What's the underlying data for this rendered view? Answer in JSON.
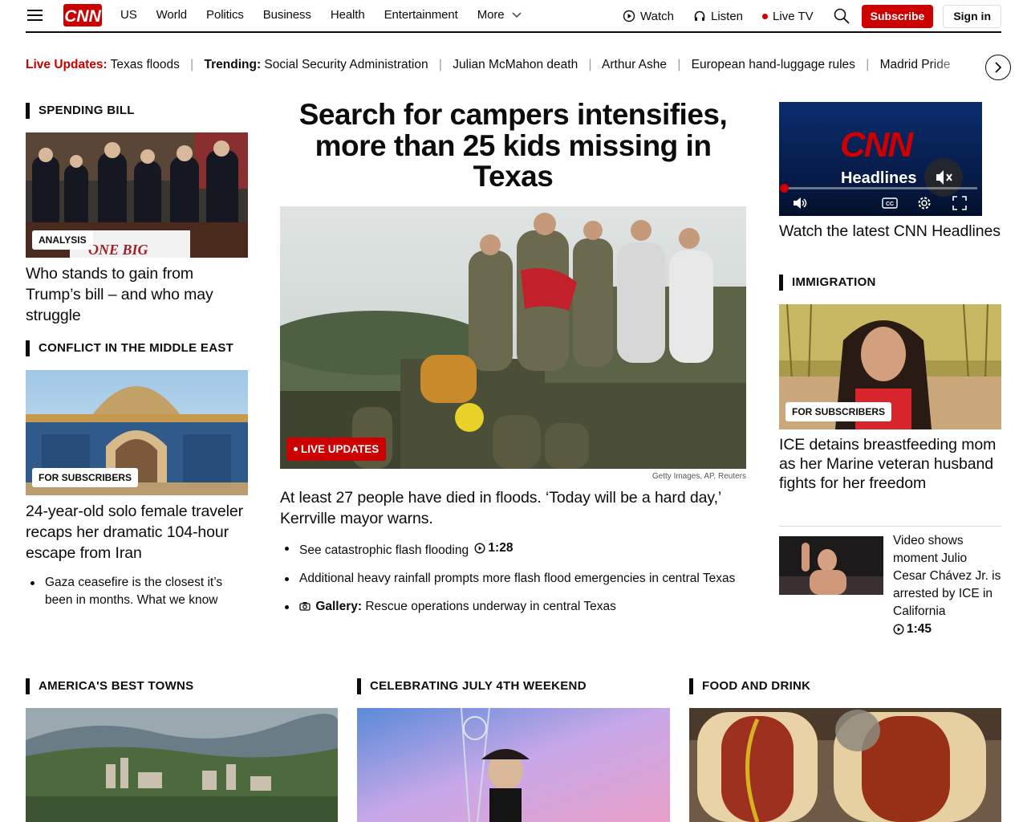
{
  "header": {
    "logo_text": "CNN",
    "nav": [
      "US",
      "World",
      "Politics",
      "Business",
      "Health",
      "Entertainment"
    ],
    "more_label": "More",
    "watch_label": "Watch",
    "listen_label": "Listen",
    "livetv_label": "Live TV",
    "subscribe_label": "Subscribe",
    "signin_label": "Sign in"
  },
  "ticker": {
    "live_label": "Live Updates:",
    "live_item": "Texas floods",
    "trending_label": "Trending:",
    "items": [
      "Social Security Administration",
      "Julian McMahon death",
      "Arthur Ashe",
      "European hand-luggage rules",
      "Madrid Pride"
    ]
  },
  "left": {
    "s1_label": "SPENDING BILL",
    "s1_badge": "ANALYSIS",
    "s1_banner": "ONE BIG",
    "s1_headline": "Who stands to gain from Trump’s bill – and who may struggle",
    "s2_label": "CONFLICT IN THE MIDDLE EAST",
    "s2_badge": "FOR SUBSCRIBERS",
    "s2_headline": "24-year-old solo female traveler recaps her dramatic 104-hour escape from Iran",
    "s2_bullet": "Gaza ceasefire is the closest it’s been in months. What we know"
  },
  "main": {
    "title": "Search for campers intensifies, more than 25 kids missing in Texas",
    "live_badge": "LIVE UPDATES",
    "credit": "Getty Images, AP, Reuters",
    "subhead": "At least 27 people have died in floods. ‘Today will be a hard day,’ Kerrville mayor warns.",
    "bullet1": "See catastrophic flash flooding",
    "bullet1_duration": "1:28",
    "bullet2": "Additional heavy rainfall prompts more flash flood emergencies in central Texas",
    "bullet3_label": "Gallery:",
    "bullet3": "Rescue operations underway in central Texas"
  },
  "right": {
    "video_brand": "CNN",
    "video_title": "Headlines",
    "video_caption": "Watch the latest CNN Headlines",
    "s_label": "IMMIGRATION",
    "s_badge": "FOR SUBSCRIBERS",
    "s_headline": "ICE detains breastfeeding mom as her Marine veteran husband fights for her freedom",
    "small_headline": "Video shows moment Julio Cesar Chávez Jr. is arrested by ICE in California",
    "small_duration": "1:45"
  },
  "bottom": {
    "c1_label": "AMERICA'S BEST TOWNS",
    "c2_label": "CELEBRATING JULY 4TH WEEKEND",
    "c3_label": "FOOD AND DRINK"
  },
  "colors": {
    "brand_red": "#cc0000",
    "text": "#0c0c0c"
  }
}
